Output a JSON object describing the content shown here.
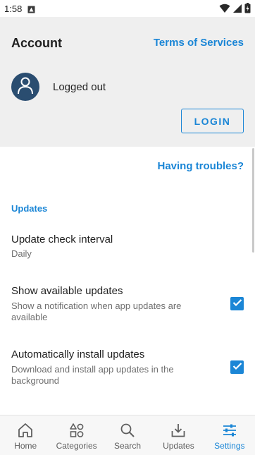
{
  "status_bar": {
    "time": "1:58"
  },
  "account": {
    "title": "Account",
    "terms_link": "Terms of Services",
    "login_status": "Logged out",
    "login_button": "LOGIN"
  },
  "settings": {
    "troubles_link": "Having troubles?",
    "section_header": "Updates",
    "items": [
      {
        "title": "Update check interval",
        "summary": "Daily"
      },
      {
        "title": "Show available updates",
        "summary": "Show a notification when app updates are available",
        "checked": true
      },
      {
        "title": "Automatically install updates",
        "summary": "Download and install app updates in the background",
        "checked": true
      }
    ]
  },
  "nav": {
    "items": [
      {
        "label": "Home",
        "icon": "home-icon"
      },
      {
        "label": "Categories",
        "icon": "categories-icon"
      },
      {
        "label": "Search",
        "icon": "search-icon"
      },
      {
        "label": "Updates",
        "icon": "download-icon"
      },
      {
        "label": "Settings",
        "icon": "settings-sliders-icon",
        "active": true
      }
    ]
  },
  "colors": {
    "accent": "#1b86d6",
    "avatar": "#2a4d70",
    "header_bg": "#efefef"
  }
}
